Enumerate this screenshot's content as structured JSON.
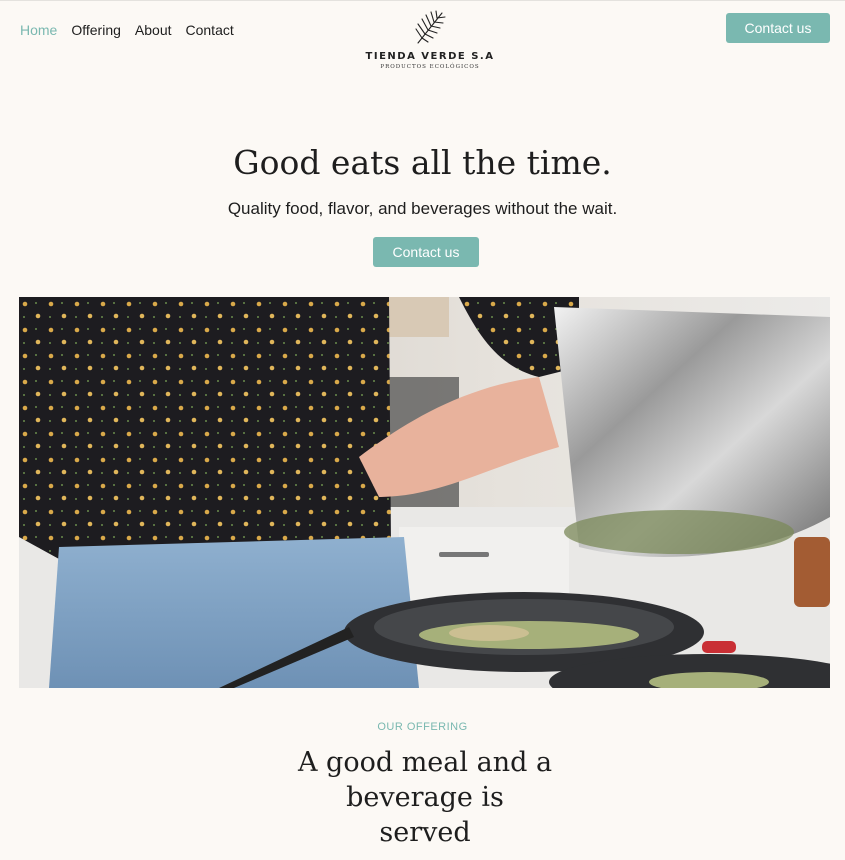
{
  "nav": {
    "items": [
      {
        "label": "Home",
        "active": true
      },
      {
        "label": "Offering",
        "active": false
      },
      {
        "label": "About",
        "active": false
      },
      {
        "label": "Contact",
        "active": false
      }
    ]
  },
  "brand": {
    "name": "TIENDA VERDE S.A",
    "tagline": "PRODUCTOS ECOLÓGICOS",
    "icon": "palm-leaf-icon"
  },
  "header": {
    "cta_label": "Contact us"
  },
  "hero": {
    "title": "Good eats all the time.",
    "subtitle": "Quality food, flavor, and beverages without the wait.",
    "cta_label": "Contact us"
  },
  "offering": {
    "eyebrow": "OUR OFFERING",
    "title": "A good meal and a beverage is served"
  },
  "colors": {
    "accent": "#7ab8b0",
    "background": "#fcf9f5",
    "text": "#1e1e1e"
  }
}
